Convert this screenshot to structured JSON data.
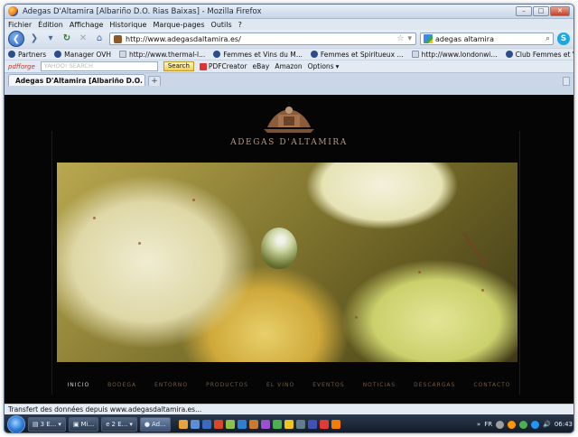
{
  "window": {
    "title": "Adegas D'Altamira [Albariño D.O. Rias Baixas] - Mozilla Firefox"
  },
  "menu": [
    "Fichier",
    "Édition",
    "Affichage",
    "Historique",
    "Marque-pages",
    "Outils",
    "?"
  ],
  "nav": {
    "url": "http://www.adegasdaltamira.es/",
    "search_value": "adegas altamira"
  },
  "bookmarks": [
    "Partners",
    "Manager OVH",
    "http://www.thermal-l...",
    "Femmes et Vins du M...",
    "Femmes et Spiritueux ...",
    "http://www.londonwi...",
    "Club Femmes et Vins ..."
  ],
  "toolbar2": {
    "brand": "pdfforge",
    "yahoo_placeholder": "YAHOO! SEARCH",
    "search_btn": "Search",
    "items": [
      "PDFCreator",
      "eBay",
      "Amazon",
      "Options"
    ]
  },
  "tab": {
    "label": "Adegas D'Altamira [Albariño D.O. Rías..."
  },
  "site": {
    "logo_text": "ADEGAS D'ALTAMIRA",
    "nav": [
      "INICIO",
      "BODEGA",
      "ENTORNO",
      "PRODUCTOS",
      "EL VINO",
      "EVENTOS",
      "NOTICIAS",
      "DESCARGAS",
      "CONTACTO"
    ]
  },
  "status": "Transfert des données depuis www.adegasdaltamira.es...",
  "taskbar": {
    "buttons": [
      "3 E...",
      "Mi...",
      "2 E...",
      "Ad..."
    ],
    "lang": "FR",
    "clock": "06:43"
  },
  "colors": {
    "accent_gold": "#b99877",
    "page_bg": "#050505",
    "nav_inactive": "#7a5b3f"
  }
}
